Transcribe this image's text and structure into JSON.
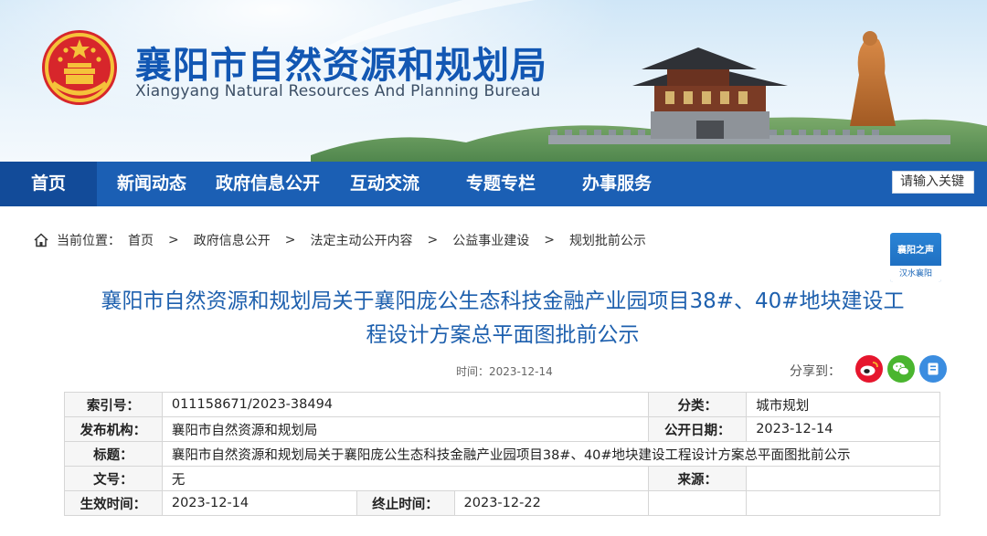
{
  "header": {
    "title": "襄阳市自然资源和规划局",
    "subtitle": "Xiangyang Natural Resources And Planning Bureau"
  },
  "nav": {
    "items": [
      "首页",
      "新闻动态",
      "政府信息公开",
      "互动交流",
      "专题专栏",
      "办事服务"
    ],
    "search_placeholder": "请输入关键"
  },
  "breadcrumb": {
    "label": "当前位置：",
    "items": [
      "首页",
      "政府信息公开",
      "法定主动公开内容",
      "公益事业建设",
      "规划批前公示"
    ],
    "separator": ">"
  },
  "badge": {
    "line1": "襄阳之声",
    "line2": "汉水襄阳"
  },
  "article": {
    "title_line1": "襄阳市自然资源和规划局关于襄阳庞公生态科技金融产业园项目38#、40#地块建设工",
    "title_line2": "程设计方案总平面图批前公示",
    "time": "时间：2023-12-14",
    "share_label": "分享到："
  },
  "share": {
    "icons": [
      "weibo-icon",
      "wechat-icon",
      "qzone-icon"
    ],
    "colors": {
      "weibo": "#e6162d",
      "wechat": "#4ab52f",
      "other": "#3b8de0"
    }
  },
  "info_table": {
    "index_label": "索引号：",
    "index_value": "011158671/2023-38494",
    "category_label": "分类：",
    "category_value": "城市规划",
    "publisher_label": "发布机构：",
    "publisher_value": "襄阳市自然资源和规划局",
    "date_label": "公开日期：",
    "date_value": "2023-12-14",
    "title_label": "标题：",
    "title_value": "襄阳市自然资源和规划局关于襄阳庞公生态科技金融产业园项目38#、40#地块建设工程设计方案总平面图批前公示",
    "docno_label": "文号：",
    "docno_value": "无",
    "source_label": "来源：",
    "source_value": "",
    "effective_label": "生效时间：",
    "effective_value": "2023-12-14",
    "end_label": "终止时间：",
    "end_value": "2023-12-22"
  },
  "colors": {
    "nav_bg": "#1b5fb4",
    "nav_active": "#124b99",
    "title_blue": "#1257b3",
    "article_title": "#1e60ae"
  }
}
